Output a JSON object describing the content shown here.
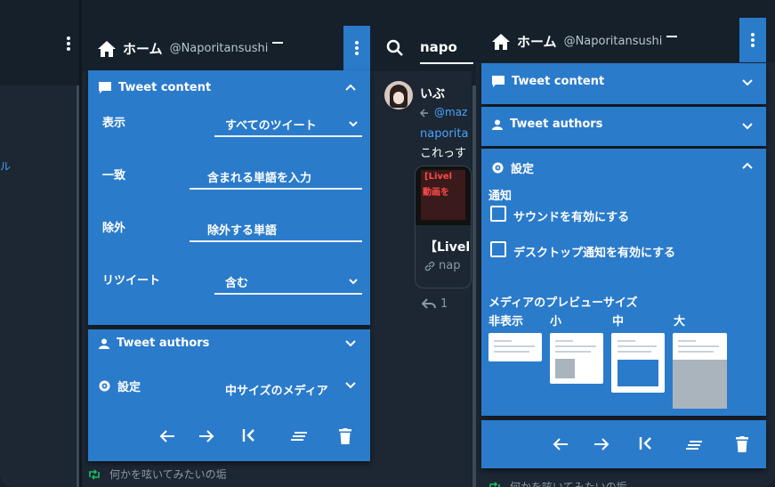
{
  "left_panel": {
    "title": "ホーム",
    "handle": "@Naporitansushi",
    "tweet_content_label": "Tweet content",
    "fields": {
      "display_label": "表示",
      "display_value": "すべてのツイート",
      "match_label": "一致",
      "match_value": "含まれる単語を入力",
      "exclude_label": "除外",
      "exclude_value": "除外する単語",
      "retweet_label": "リツイート",
      "retweet_value": "含む"
    },
    "tweet_authors_label": "Tweet authors",
    "settings_label": "設定",
    "settings_value": "中サイズのメディア",
    "compose_placeholder": "何かを呟いてみたいの垢"
  },
  "middle_column": {
    "tab_label": "napo",
    "tweet_author": "いぶ",
    "reply_to": "@maz",
    "link_text": "naporita",
    "tweet_text": "これっす",
    "card_title": "【Livel",
    "card_domain": "nap",
    "reply_count": "1",
    "thumb_text_1": "[Livel",
    "thumb_text_2": "動画を"
  },
  "side_fragment": {
    "text": "ル"
  },
  "right_panel": {
    "title": "ホーム",
    "handle": "@Naporitansushi",
    "tweet_content_label": "Tweet content",
    "tweet_authors_label": "Tweet authors",
    "settings_label": "設定",
    "notification_heading": "通知",
    "sound_label": "サウンドを有効にする",
    "desktop_label": "デスクトップ通知を有効にする",
    "media_preview_heading": "メディアのプレビューサイズ",
    "sizes": [
      "非表示",
      "小",
      "中",
      "大"
    ],
    "sound_checked": false,
    "desktop_checked": false,
    "selected_size": "中",
    "compose_placeholder": "何かを呟いてみたいの垢"
  },
  "colors": {
    "accent": "#2b7bcb",
    "background": "#15202b",
    "dark_bar": "#0f1419"
  }
}
